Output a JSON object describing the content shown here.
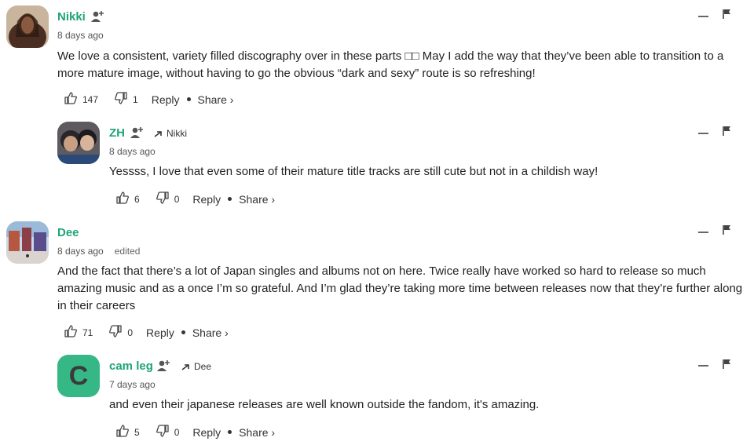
{
  "comments": [
    {
      "author": "Nikki",
      "time": "8 days ago",
      "edited": "",
      "reply_to": "",
      "body": "We love a consistent, variety filled discography over in these parts □□ May I add the way that they’ve been able to transition to a more mature image, without having to go the obvious “dark and sexy” route is so refreshing!",
      "likes": "147",
      "dislikes": "1",
      "reply_label": "Reply",
      "share_label": "Share ›",
      "avatar_color": "#6b4a3a"
    },
    {
      "author": "ZH",
      "time": "8 days ago",
      "edited": "",
      "reply_to": "Nikki",
      "body": "Yessss, I love that even some of their mature title tracks are still cute but not in a childish way!",
      "likes": "6",
      "dislikes": "0",
      "reply_label": "Reply",
      "share_label": "Share ›",
      "avatar_color": "#3d3b40"
    },
    {
      "author": "Dee",
      "time": "8 days ago",
      "edited": "edited",
      "reply_to": "",
      "body": "And the fact that there’s a lot of Japan singles and albums not on here. Twice really have worked so hard to release so much amazing music and as a once I’m so grateful. And I’m glad they’re taking more time between releases now that they’re further along in their careers",
      "likes": "71",
      "dislikes": "0",
      "reply_label": "Reply",
      "share_label": "Share ›",
      "avatar_color": "#7aa0c8"
    },
    {
      "author": "cam leg",
      "time": "7 days ago",
      "edited": "",
      "reply_to": "Dee",
      "avatar_letter": "C",
      "body": "and even their japanese releases are well known outside the fandom, it's amazing.",
      "likes": "5",
      "dislikes": "0",
      "reply_label": "Reply",
      "share_label": "Share ›",
      "avatar_color": "#36b886"
    }
  ],
  "colors": {
    "accent": "#1fa37a",
    "text": "#222222",
    "muted": "#555555"
  }
}
